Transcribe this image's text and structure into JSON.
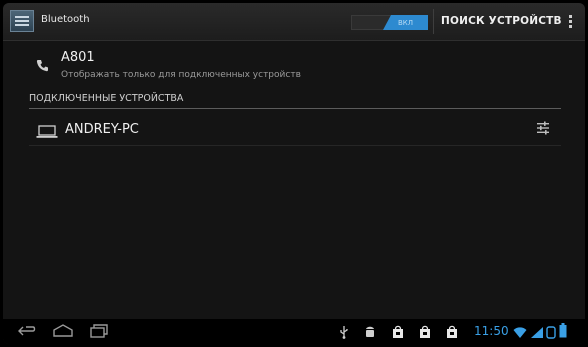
{
  "actionbar": {
    "title": "Bluetooth",
    "toggle_label": "ВКЛ",
    "scan_label": "ПОИСК УСТРОЙСТВ"
  },
  "this_device": {
    "name": "A801",
    "subtitle": "Отображать только для подключенных устройств"
  },
  "paired_section": {
    "header": "ПОДКЛЮЧЕННЫЕ УСТРОЙСТВА",
    "devices": [
      {
        "name": "ANDREY-PC"
      }
    ]
  },
  "status_bar": {
    "time": "11:50"
  },
  "colors": {
    "accent": "#2d8ad0",
    "clock": "#3aa0e6"
  }
}
